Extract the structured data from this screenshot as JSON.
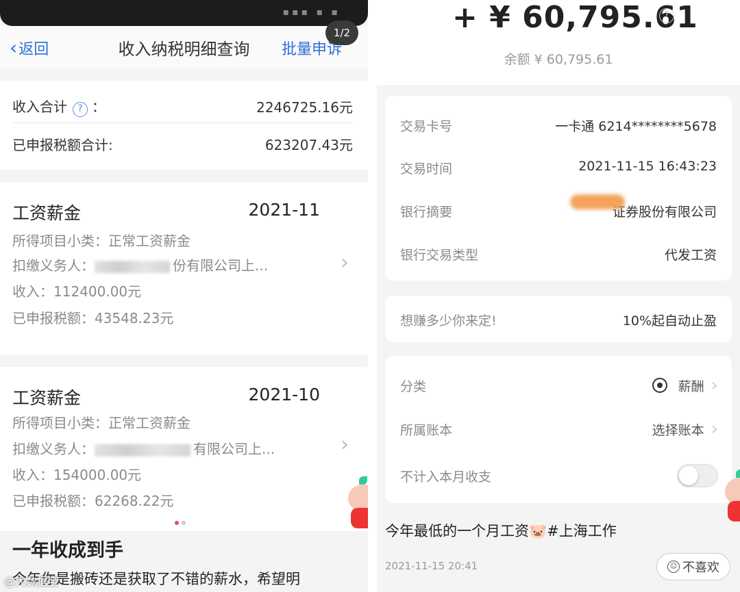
{
  "left": {
    "nav": {
      "back_label": "返回",
      "title": "收入纳税明细查询",
      "action": "批量申诉"
    },
    "page_badge": "1/2",
    "summary": {
      "income_total_label": "收入合计",
      "income_total_suffix": "：",
      "income_total_value": "2246725.16元",
      "tax_total_label": "已申报税额合计:",
      "tax_total_value": "623207.43元"
    },
    "records": [
      {
        "type": "工资薪金",
        "period": "2021-11",
        "subcategory": "所得项目小类：正常工资薪金",
        "payer_label": "扣缴义务人：",
        "payer_visible": "份有限公司上...",
        "income": "收入：112400.00元",
        "tax": "已申报税额：43548.23元"
      },
      {
        "type": "工资薪金",
        "period": "2021-10",
        "subcategory": "所得项目小类：正常工资薪金",
        "payer_label": "扣缴义务人：",
        "payer_visible": "有限公司上...",
        "income": "收入：154000.00元",
        "tax": "已申报税额：62268.22元"
      }
    ],
    "bottom_title": "一年收成到手",
    "bottom_text": "今年你是搬砖还是获取了不错的薪水，希望明",
    "watermark": "@大数据宝"
  },
  "right": {
    "amount": "+ ¥ 60,795.61",
    "balance": "余额 ¥ 60,795.61",
    "details": [
      {
        "key": "交易卡号",
        "value": "一卡通 6214********5678"
      },
      {
        "key": "交易时间",
        "value": "2021-11-15 16:43:23"
      },
      {
        "key": "银行摘要",
        "value": "证券股份有限公司"
      },
      {
        "key": "银行交易类型",
        "value": "代发工资"
      }
    ],
    "promo": {
      "key": "想赚多少你来定!",
      "value": "10%起自动止盈"
    },
    "settings": {
      "category_key": "分类",
      "category_value": "薪酬",
      "ledger_key": "所属账本",
      "ledger_value": "选择账本",
      "exclude_key": "不计入本月收支",
      "exclude_on": false
    },
    "post_text": "今年最低的一个月工资🐷#上海工作",
    "post_date": "2021-11-15 20:41",
    "dislike_label": "不喜欢"
  },
  "colors": {
    "link_blue": "#2f6fd8",
    "smudge_orange": "#f29a4b",
    "pager_active": "#e84b6a"
  },
  "icons": [
    "back-chevron-icon",
    "help-circle-icon",
    "chevron-right-icon",
    "wallet-icon",
    "face-icon"
  ]
}
